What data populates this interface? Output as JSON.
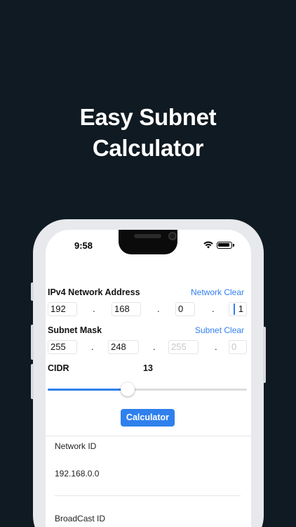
{
  "headline": {
    "line1": "Easy Subnet",
    "line2": "Calculator"
  },
  "status_bar": {
    "time": "9:58"
  },
  "network": {
    "label": "IPv4 Network Address",
    "clear_label": "Network Clear",
    "octets": [
      "192",
      "168",
      "0",
      "1"
    ]
  },
  "mask": {
    "label": "Subnet Mask",
    "clear_label": "Subnet Clear",
    "octets": [
      "255",
      "248"
    ],
    "placeholders": [
      "255",
      "0"
    ]
  },
  "separator": ".",
  "cidr": {
    "label": "CIDR",
    "value": "13",
    "slider_fraction": 0.4
  },
  "calculate_button": "Calculator",
  "results": {
    "network_id_label": "Network ID",
    "network_id_value": "192.168.0.0",
    "broadcast_id_label": "BroadCast ID"
  },
  "colors": {
    "accent": "#2f80ed",
    "background": "#0f1a22"
  }
}
